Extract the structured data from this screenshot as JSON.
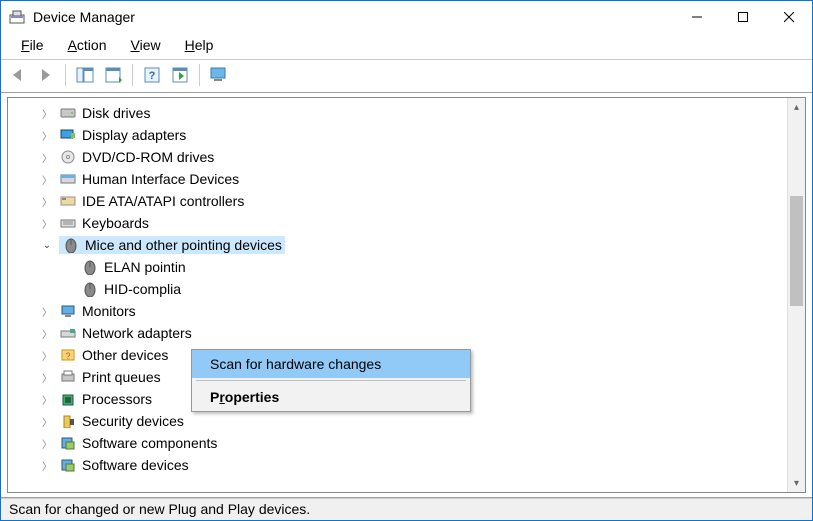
{
  "window": {
    "title": "Device Manager"
  },
  "menubar": {
    "file": "File",
    "action": "Action",
    "view": "View",
    "help": "Help"
  },
  "tree": {
    "items": [
      {
        "label": "Disk drives",
        "expanded": false
      },
      {
        "label": "Display adapters",
        "expanded": false
      },
      {
        "label": "DVD/CD-ROM drives",
        "expanded": false
      },
      {
        "label": "Human Interface Devices",
        "expanded": false
      },
      {
        "label": "IDE ATA/ATAPI controllers",
        "expanded": false
      },
      {
        "label": "Keyboards",
        "expanded": false
      },
      {
        "label": "Mice and other pointing devices",
        "expanded": true,
        "selected": true,
        "children": [
          {
            "label": "ELAN pointin"
          },
          {
            "label": "HID-complia"
          }
        ]
      },
      {
        "label": "Monitors",
        "expanded": false
      },
      {
        "label": "Network adapters",
        "expanded": false
      },
      {
        "label": "Other devices",
        "expanded": false
      },
      {
        "label": "Print queues",
        "expanded": false
      },
      {
        "label": "Processors",
        "expanded": false
      },
      {
        "label": "Security devices",
        "expanded": false
      },
      {
        "label": "Software components",
        "expanded": false
      },
      {
        "label": "Software devices",
        "expanded": false
      }
    ]
  },
  "context_menu": {
    "scan": "Scan for hardware changes",
    "properties": "Properties"
  },
  "statusbar": {
    "text": "Scan for changed or new Plug and Play devices."
  }
}
